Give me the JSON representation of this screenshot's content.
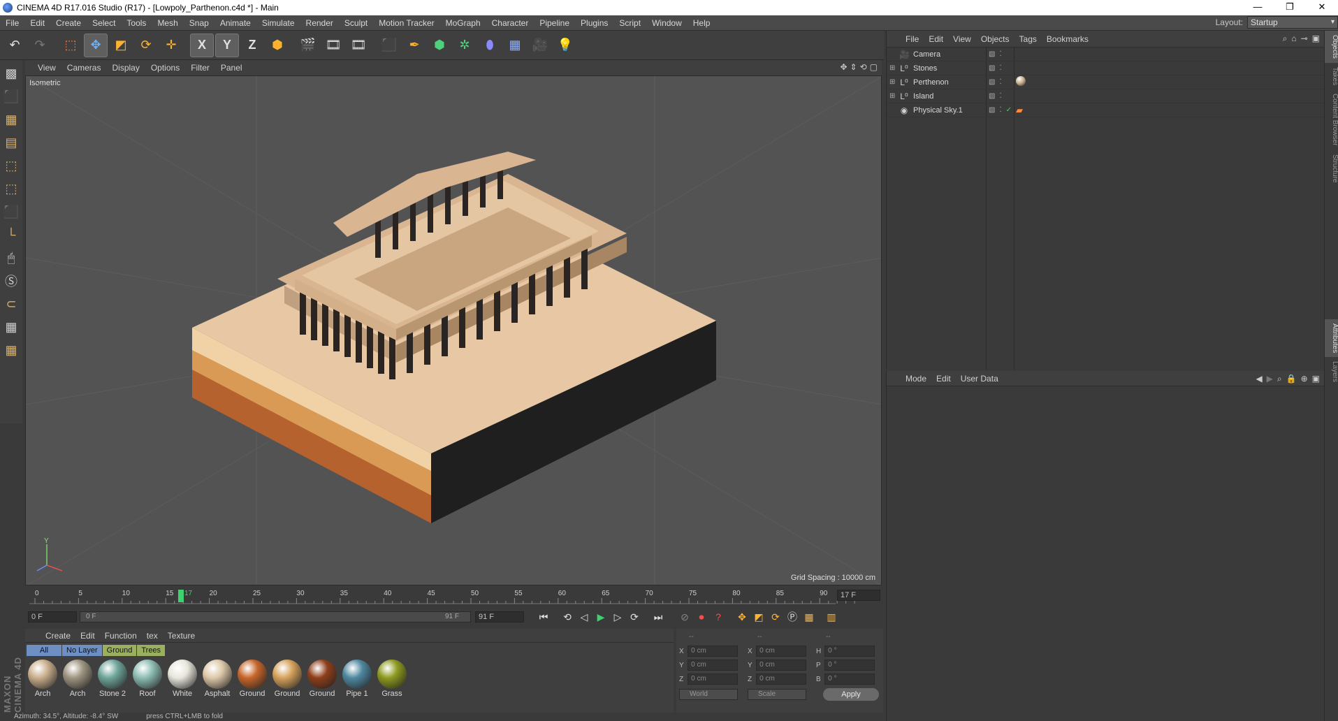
{
  "window": {
    "title": "CINEMA 4D R17.016 Studio (R17) - [Lowpoly_Parthenon.c4d *] - Main",
    "controls": [
      "—",
      "❐",
      "✕"
    ]
  },
  "menubar": {
    "items": [
      "File",
      "Edit",
      "Create",
      "Select",
      "Tools",
      "Mesh",
      "Snap",
      "Animate",
      "Simulate",
      "Render",
      "Sculpt",
      "Motion Tracker",
      "MoGraph",
      "Character",
      "Pipeline",
      "Plugins",
      "Script",
      "Window",
      "Help"
    ],
    "layout_label": "Layout:",
    "layout_value": "Startup"
  },
  "toolbar": {
    "axis_x": "X",
    "axis_y": "Y",
    "axis_z": "Z"
  },
  "viewport": {
    "menu": [
      "View",
      "Cameras",
      "Display",
      "Options",
      "Filter",
      "Panel"
    ],
    "label": "Isometric",
    "grid_spacing": "Grid Spacing : 10000 cm",
    "axis_y": "Y"
  },
  "timeline": {
    "ticks": [
      "0",
      "5",
      "10",
      "15",
      "20",
      "25",
      "30",
      "35",
      "40",
      "45",
      "50",
      "55",
      "60",
      "65",
      "70",
      "75",
      "80",
      "85",
      "90"
    ],
    "current_marker": "17",
    "current_frame_field": "17 F"
  },
  "playbar": {
    "start_field": "0 F",
    "range_start": "0 F",
    "range_end": "91 F",
    "end_field": "91 F"
  },
  "materials": {
    "menu": [
      "Create",
      "Edit",
      "Function",
      "tex",
      "Texture"
    ],
    "filters": [
      "All",
      "No Layer",
      "Ground",
      "Trees"
    ],
    "items": [
      {
        "name": "Arch",
        "color": "#c9ae8c"
      },
      {
        "name": "Arch",
        "color": "#9e9480"
      },
      {
        "name": "Stone 2",
        "color": "#6fa59a"
      },
      {
        "name": "Roof",
        "color": "#8cbdb3"
      },
      {
        "name": "White",
        "color": "#e8e6dc"
      },
      {
        "name": "Asphalt",
        "color": "#ddc8a8"
      },
      {
        "name": "Ground",
        "color": "#c7652a"
      },
      {
        "name": "Ground",
        "color": "#d6a25c"
      },
      {
        "name": "Ground",
        "color": "#8e3f1a"
      },
      {
        "name": "Pipe 1",
        "color": "#4f88a0"
      },
      {
        "name": "Grass",
        "color": "#8e9a1f"
      }
    ]
  },
  "coordinates": {
    "header": [
      "--",
      "--",
      "--"
    ],
    "rows": [
      {
        "l1": "X",
        "v1": "0 cm",
        "l2": "X",
        "v2": "0 cm",
        "l3": "H",
        "v3": "0 °"
      },
      {
        "l1": "Y",
        "v1": "0 cm",
        "l2": "Y",
        "v2": "0 cm",
        "l3": "P",
        "v3": "0 °"
      },
      {
        "l1": "Z",
        "v1": "0 cm",
        "l2": "Z",
        "v2": "0 cm",
        "l3": "B",
        "v3": "0 °"
      }
    ],
    "world": "World",
    "scale": "Scale",
    "apply": "Apply"
  },
  "status": {
    "left": "Azimuth: 34.5°, Altitude: -8.4° SW",
    "right": "press CTRL+LMB to fold"
  },
  "objects": {
    "menu": [
      "File",
      "Edit",
      "View",
      "Objects",
      "Tags",
      "Bookmarks"
    ],
    "items": [
      {
        "name": "Camera",
        "icon": "camera-icon"
      },
      {
        "name": "Stones",
        "icon": "null-icon"
      },
      {
        "name": "Perthenon",
        "icon": "null-icon"
      },
      {
        "name": "Island",
        "icon": "null-icon"
      },
      {
        "name": "Physical Sky.1",
        "icon": "sky-icon"
      }
    ]
  },
  "attributes": {
    "menu": [
      "Mode",
      "Edit",
      "User Data"
    ]
  },
  "side_tabs": [
    "Objects",
    "Takes",
    "Content Browser",
    "Structure",
    "Attributes",
    "Layers"
  ],
  "branding": "MAXON CINEMA 4D"
}
